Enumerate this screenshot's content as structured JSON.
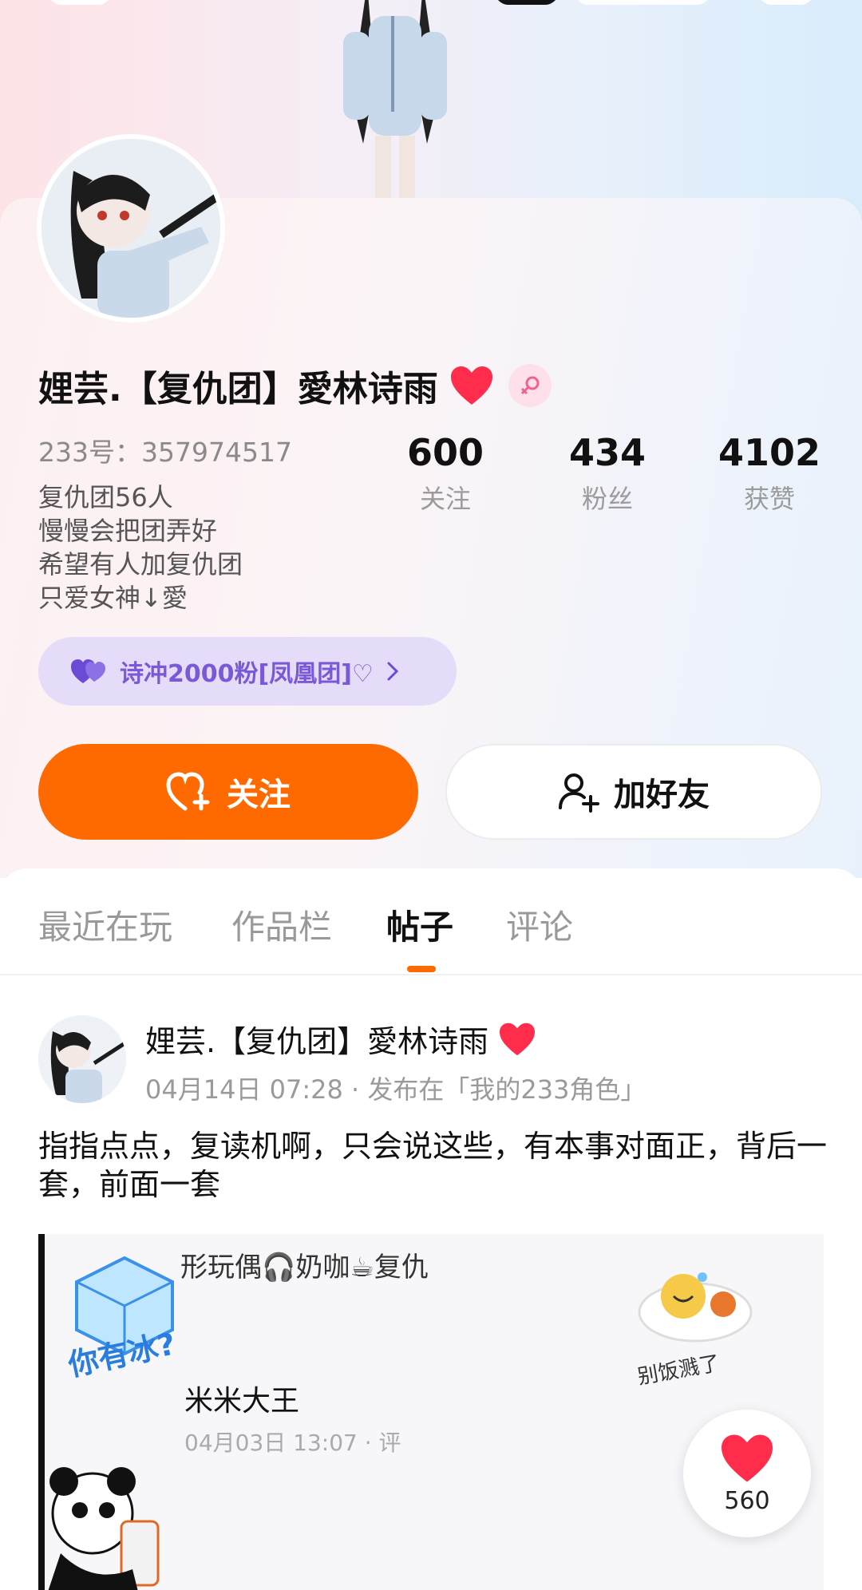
{
  "profile": {
    "stats": [
      {
        "value": "600",
        "label": "关注"
      },
      {
        "value": "434",
        "label": "粉丝"
      },
      {
        "value": "4102",
        "label": "获赞"
      }
    ],
    "name": "娌芸.【复仇团】愛林诗雨",
    "uid": "233号：357974517",
    "bio": [
      "复仇团56人",
      "慢慢会把团弄好",
      "希望有人加复仇团",
      "只爱女神↓愛"
    ],
    "group_tag": "诗冲2000粉[凤凰团]♡",
    "follow_label": "关注",
    "add_friend_label": "加好友"
  },
  "tabs": [
    {
      "label": "最近在玩",
      "active": false
    },
    {
      "label": "作品栏",
      "active": false
    },
    {
      "label": "帖子",
      "active": true
    },
    {
      "label": "评论",
      "active": false
    }
  ],
  "post": {
    "author": "娌芸.【复仇团】愛林诗雨",
    "meta": "04月14日 07:28 · 发布在「我的233角色」",
    "text": "指指点点，复读机啊，只会说这些，有本事对面正，背后一套，前面一套",
    "image": {
      "line1": "形玩偶🎧奶咖☕复仇",
      "ice_text": "你有冰?",
      "rice_text": "别饭溅了",
      "inner_name": "米米大王",
      "inner_date": "04月03日 13:07 · 评"
    }
  },
  "like": {
    "count": "560"
  },
  "colors": {
    "accent": "#ff6a00",
    "group_tag_bg": "#e5dcfa",
    "group_tag_text": "#7a59d8",
    "heart": "#ff2d4b"
  }
}
